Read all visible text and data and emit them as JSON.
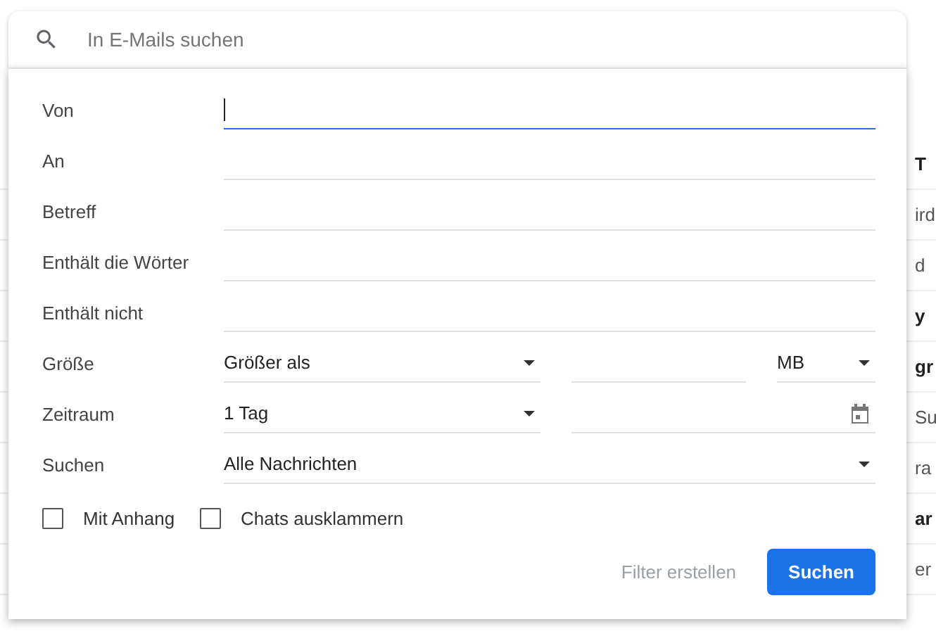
{
  "search": {
    "placeholder": "In E-Mails suchen"
  },
  "fields": [
    {
      "kind": "text",
      "label": "Von",
      "focused": true
    },
    {
      "kind": "text",
      "label": "An",
      "focused": false
    },
    {
      "kind": "text",
      "label": "Betreff",
      "focused": false
    },
    {
      "kind": "text",
      "label": "Enthält die Wörter",
      "focused": false
    },
    {
      "kind": "text",
      "label": "Enthält nicht",
      "focused": false
    },
    {
      "kind": "size",
      "label": "Größe",
      "value": "Größer als",
      "unit": "MB"
    },
    {
      "kind": "date",
      "label": "Zeitraum",
      "value": "1 Tag"
    },
    {
      "kind": "select",
      "label": "Suchen",
      "value": "Alle Nachrichten"
    }
  ],
  "checkboxes": [
    {
      "label": "Mit Anhang",
      "checked": false
    },
    {
      "label": "Chats ausklammern",
      "checked": false
    }
  ],
  "buttons": [
    {
      "kind": "text",
      "label": "Filter erstellen"
    },
    {
      "kind": "primary",
      "label": "Suchen"
    }
  ],
  "background_rows": [
    {
      "text": "T",
      "bold": true
    },
    {
      "text": "ird",
      "bold": false
    },
    {
      "text": "d",
      "bold": false
    },
    {
      "text": "y",
      "bold": true
    },
    {
      "text": "gr",
      "bold": true
    },
    {
      "text": "Su",
      "bold": false
    },
    {
      "text": "ra",
      "bold": false
    },
    {
      "text": "ar",
      "bold": true
    },
    {
      "text": "er",
      "bold": false
    }
  ]
}
